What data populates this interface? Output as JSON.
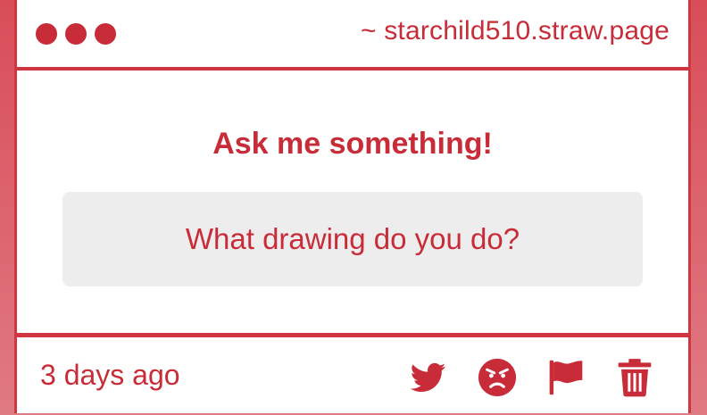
{
  "window": {
    "address": "~ starchild510.straw.page"
  },
  "prompt": {
    "heading": "Ask me something!",
    "question": "What drawing do you do?"
  },
  "footer": {
    "time_ago": "3 days ago",
    "actions": [
      "twitter-icon",
      "angry-face-icon",
      "flag-icon",
      "trash-icon"
    ]
  },
  "colors": {
    "accent": "#c82c38",
    "border": "#cf3640",
    "question_bg": "#eeedee",
    "background_top": "#d84d58"
  }
}
